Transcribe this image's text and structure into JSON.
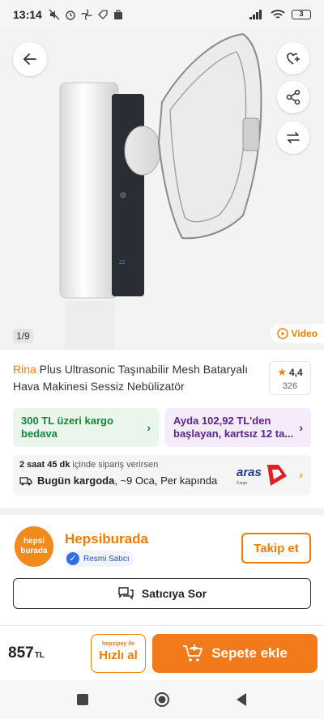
{
  "status": {
    "time": "13:14",
    "battery": "3"
  },
  "hero": {
    "page_indicator": "1/9",
    "video_label": "Video"
  },
  "product": {
    "brand": "Rina",
    "title": " Plus Ultrasonic Taşınabilir Mesh Bataryalı Hava Makinesi Sessiz Nebülizatör",
    "rating": "4,4",
    "review_count": "326"
  },
  "promos": {
    "shipping": "300 TL üzeri kargo bedava",
    "installment": "Ayda 102,92 TL'den başlayan, kartsız 12 ta..."
  },
  "delivery": {
    "countdown_bold": "2 saat 45 dk",
    "countdown_rest": " içinde sipariş verirsen",
    "ship_bold": "Bugün kargoda",
    "ship_rest": ", ~9 Oca, Per kapında",
    "carrier": "aras",
    "carrier_tagline": "Kargo"
  },
  "seller": {
    "logo_line1": "hepsi",
    "logo_line2": "burada",
    "name": "Hepsiburada",
    "badge": "Resmi Satıcı",
    "follow_label": "Takip et",
    "ask_label": "Satıcıya Sor"
  },
  "purchase": {
    "price": "857",
    "currency": "TL",
    "quick_buy_top": "hepsipay ile",
    "quick_buy_label": "Hızlı al",
    "add_to_cart_label": "Sepete ekle"
  },
  "colors": {
    "accent": "#f07d00",
    "green": "#13873a",
    "purple": "#5b2486"
  }
}
